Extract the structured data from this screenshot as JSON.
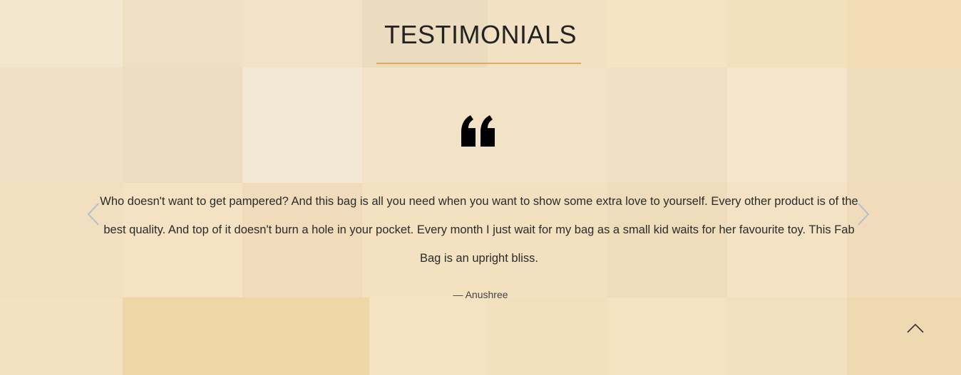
{
  "section": {
    "title": "TESTIMONIALS",
    "accent_color": "#e0a95e",
    "background_color": "#f3e3c4"
  },
  "testimonial": {
    "quote_icon": "quote-open-icon",
    "text": "Who doesn't want to get pampered? And this bag is all you need when you want to show some extra love to yourself. Every other product is of the best quality. And top of it doesn't burn a hole in your pocket. Every month I just wait for my bag as a small kid waits for her favourite toy. This Fab Bag is an upright bliss.",
    "author": "— Anushree"
  },
  "carousel": {
    "prev_icon": "chevron-left-icon",
    "next_icon": "chevron-right-icon"
  },
  "scroll_top": {
    "icon": "chevron-up-icon"
  }
}
